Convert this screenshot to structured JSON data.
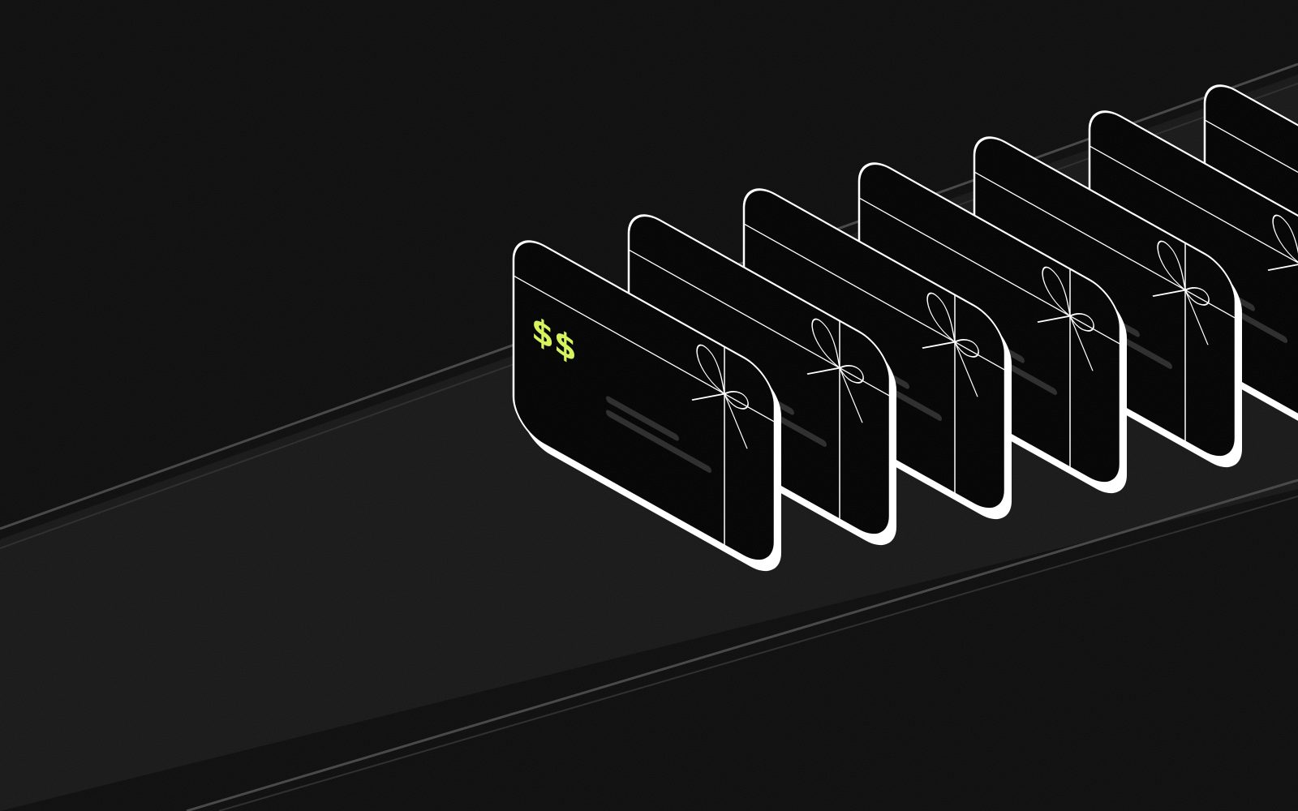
{
  "scene": {
    "card_count": 7,
    "front_card_symbol": "$$",
    "colors": {
      "background": "#0b0b0b",
      "belt": "#161616",
      "belt_edge": "#4a4a4a",
      "card_face": "#000000",
      "card_outline": "#ffffff",
      "card_text_bars": "#2a2a2a",
      "accent": "#d4f45a"
    },
    "icons": [
      "ribbon-bow-icon",
      "dollar-sign-icon"
    ]
  }
}
